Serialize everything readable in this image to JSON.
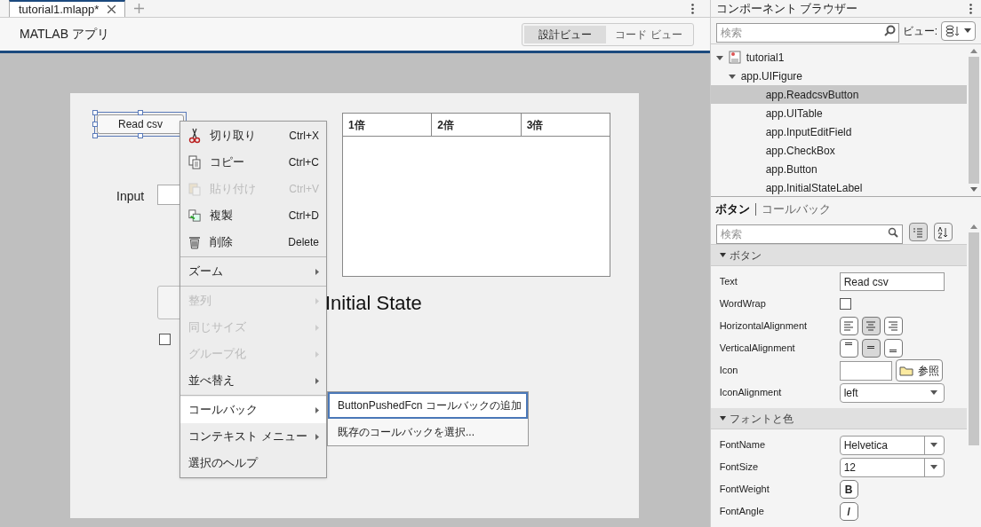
{
  "tabs": [
    {
      "label": "tutorial1.mlapp*",
      "selected": true
    }
  ],
  "toolbar": {
    "title": "MATLAB アプリ",
    "views": [
      {
        "label": "設計ビュー",
        "selected": true
      },
      {
        "label": "コード ビュー",
        "selected": false
      }
    ]
  },
  "canvas": {
    "read_button": {
      "text": "Read csv",
      "selected": true
    },
    "input_label": "Input",
    "table_columns": [
      "1倍",
      "2倍",
      "3倍"
    ],
    "state_label": "Initial State",
    "checkbox": {
      "checked": false
    }
  },
  "context_menu": {
    "groups": [
      [
        {
          "label": "切り取り",
          "shortcut": "Ctrl+X",
          "disabled": false,
          "submenu": false,
          "selected": false
        },
        {
          "label": "コピー",
          "shortcut": "Ctrl+C",
          "disabled": false,
          "submenu": false,
          "selected": false
        },
        {
          "label": "貼り付け",
          "shortcut": "Ctrl+V",
          "disabled": true,
          "submenu": false,
          "selected": false
        },
        {
          "label": "複製",
          "shortcut": "Ctrl+D",
          "disabled": false,
          "submenu": false,
          "selected": false
        },
        {
          "label": "削除",
          "shortcut": "Delete",
          "disabled": false,
          "submenu": false,
          "selected": false
        }
      ],
      [
        {
          "label": "ズーム",
          "disabled": false,
          "submenu": true,
          "selected": false
        }
      ],
      [
        {
          "label": "整列",
          "disabled": true,
          "submenu": true,
          "selected": false
        },
        {
          "label": "同じサイズ",
          "disabled": true,
          "submenu": true,
          "selected": false
        },
        {
          "label": "グループ化",
          "disabled": true,
          "submenu": true,
          "selected": false
        },
        {
          "label": "並べ替え",
          "disabled": false,
          "submenu": true,
          "selected": false
        }
      ],
      [
        {
          "label": "コールバック",
          "disabled": false,
          "submenu": true,
          "selected": true
        },
        {
          "label": "コンテキスト メニュー",
          "disabled": false,
          "submenu": true,
          "selected": false
        },
        {
          "label": "選択のヘルプ",
          "disabled": false,
          "submenu": false,
          "selected": false
        }
      ]
    ],
    "submenu": [
      {
        "label": "ButtonPushedFcn コールバックの追加",
        "selected": true
      },
      {
        "label": "既存のコールバックを選択...",
        "selected": false
      }
    ]
  },
  "browser": {
    "title": "コンポーネント ブラウザー",
    "search_placeholder": "検索",
    "view_label": "ビュー:",
    "tree": [
      {
        "label": "tutorial1",
        "expanded": true,
        "selected": false,
        "children": [
          {
            "label": "app.UIFigure",
            "expanded": true,
            "selected": false,
            "children": [
              {
                "label": "app.ReadcsvButton",
                "selected": true
              },
              {
                "label": "app.UITable",
                "selected": false
              },
              {
                "label": "app.InputEditField",
                "selected": false
              },
              {
                "label": "app.CheckBox",
                "selected": false
              },
              {
                "label": "app.Button",
                "selected": false
              },
              {
                "label": "app.InitialStateLabel",
                "selected": false
              }
            ]
          }
        ]
      }
    ]
  },
  "inspector": {
    "tabs": [
      {
        "label": "ボタン",
        "selected": true
      },
      {
        "label": "コールバック",
        "selected": false
      }
    ],
    "search_placeholder": "検索",
    "sections": [
      {
        "title": "ボタン",
        "expanded": true,
        "properties": [
          {
            "name": "Text",
            "kind": "text",
            "value": "Read csv"
          },
          {
            "name": "WordWrap",
            "kind": "checkbox",
            "checked": false
          },
          {
            "name": "HorizontalAlignment",
            "kind": "halign",
            "options": [
              {
                "selected": false
              },
              {
                "selected": true
              },
              {
                "selected": false
              }
            ]
          },
          {
            "name": "VerticalAlignment",
            "kind": "valign",
            "options": [
              {
                "selected": false
              },
              {
                "selected": true
              },
              {
                "selected": false
              }
            ]
          },
          {
            "name": "Icon",
            "kind": "file",
            "browse_label": "参照"
          },
          {
            "name": "IconAlignment",
            "kind": "dropdown",
            "value": "left"
          }
        ]
      },
      {
        "title": "フォントと色",
        "expanded": true,
        "properties": [
          {
            "name": "FontName",
            "kind": "combo",
            "value": "Helvetica"
          },
          {
            "name": "FontSize",
            "kind": "combo",
            "value": "12"
          },
          {
            "name": "FontWeight",
            "kind": "toggle",
            "glyph": "B",
            "on": false
          },
          {
            "name": "FontAngle",
            "kind": "toggle",
            "glyph": "/",
            "on": false
          }
        ]
      }
    ]
  }
}
